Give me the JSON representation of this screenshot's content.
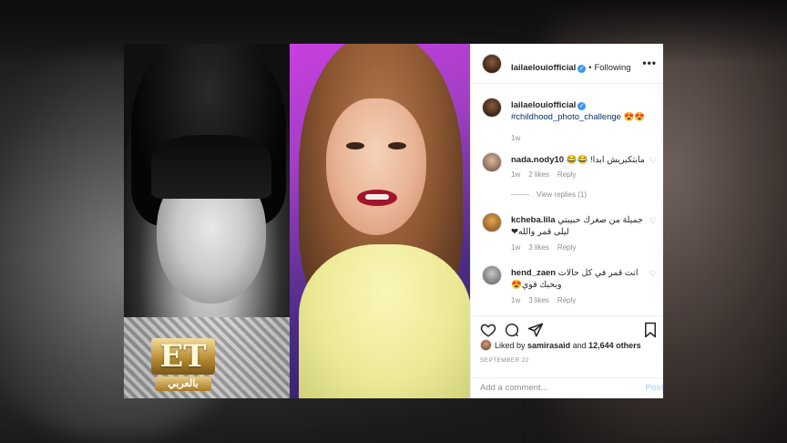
{
  "post": {
    "username": "lailaelouiofficial",
    "following_label": "Following",
    "caption": {
      "username": "lailaelouiofficial",
      "text": "#childhood_photo_challenge 😍😍",
      "age": "1w"
    },
    "comments": [
      {
        "username": "nada.nody10",
        "text": "مابتكبريش ابدا! 😂😂",
        "age": "1w",
        "likes": "2 likes",
        "reply": "Reply",
        "view_replies": "View replies (1)"
      },
      {
        "username": "kcheba.lila",
        "text": "جميلة من صغرك حبيبتي ليلى قمر والله❤",
        "age": "1w",
        "likes": "3 likes",
        "reply": "Reply"
      },
      {
        "username": "hend_zaen",
        "text": "انت قمر في كل حالات وبحبك قوي😍",
        "age": "1w",
        "likes": "3 likes",
        "reply": "Reply"
      }
    ],
    "liked_by_prefix": "Liked by",
    "liked_by_user": "samirasaid",
    "liked_by_and": "and",
    "liked_by_count": "12,644 others",
    "date": "SEPTEMBER 22",
    "add_comment_placeholder": "Add a comment...",
    "post_button": "Post"
  },
  "overlay": {
    "logo_mark": "ET",
    "logo_sub": "بالعربي"
  },
  "colors": {
    "verified": "#3897f0",
    "post_button": "#b3dbff",
    "photo_backdrop": "#c93fe0"
  },
  "icons": [
    "more-icon",
    "verified-icon",
    "heart-icon",
    "comment-icon",
    "share-icon",
    "bookmark-icon"
  ]
}
